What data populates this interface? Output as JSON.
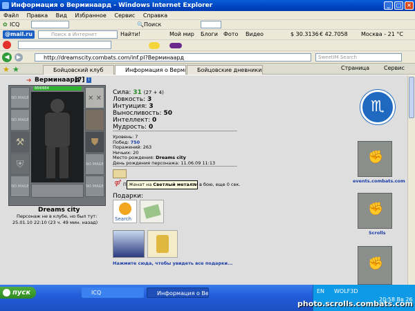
{
  "window": {
    "title": "Информация о Верминаард - Windows Internet Explorer"
  },
  "menu": [
    "Файл",
    "Правка",
    "Вид",
    "Избранное",
    "Сервис",
    "Справка"
  ],
  "toolbar1": {
    "icq": "ICQ",
    "search": "Поиск"
  },
  "toolbar2": {
    "brand": "@mail.ru",
    "search_placeholder": "Поиск в Интернет",
    "find": "Найти!",
    "my_world": "Мой мир",
    "blogs": "Блоги",
    "photo": "Фото",
    "video": "Видео",
    "usd": "$ 30.3136",
    "eur": "€ 42.7058",
    "weather": "Москва - 21 °C"
  },
  "address": {
    "url": "http://dreamscity.combats.com/inf.pl?Верминаард",
    "search_placeholder": "SweetIM Search"
  },
  "tabs": [
    "Бойцовский клуб",
    "Информация о Вермина...",
    "Бойцовские дневники - Све..."
  ],
  "tab_tools": {
    "page": "Страница",
    "service": "Сервис"
  },
  "character": {
    "name": "Верминаард",
    "level": "[7]",
    "hp": "664/664",
    "city": "Dreams city",
    "status_line": "Персонаж не в клубе, но был тут:",
    "last_seen": "25.01.10 22:10 (23 ч. 49 мин. назад)",
    "empty_slot": "NO IMAGE"
  },
  "stats": [
    {
      "label": "Сила:",
      "value": "31",
      "extra": "(27 + 4)"
    },
    {
      "label": "Ловкость:",
      "value": "3"
    },
    {
      "label": "Интуиция:",
      "value": "3"
    },
    {
      "label": "Выносливость:",
      "value": "50"
    },
    {
      "label": "Интеллект:",
      "value": "0"
    },
    {
      "label": "Мудрость:",
      "value": "0"
    }
  ],
  "details": {
    "level": "Уровень: 7",
    "wins_label": "Побед:",
    "wins": "750",
    "losses": "Поражений: 263",
    "draws": "Ничьих: 20",
    "birthplace_label": "Место рождения:",
    "birthplace": "Dreams city",
    "birthday": "День рождения персонажа: 11.06.09 11:13"
  },
  "married": {
    "tooltip_label": "Женат на",
    "tooltip_name": "Светлый металл",
    "line_prefix": "П",
    "line_rest": "ти в бою, еще 0 сек."
  },
  "gifts": {
    "label": "Подарки:",
    "gift1": "Search",
    "more": "Нажмите сюда, чтобы увидеть все подарки..."
  },
  "right_panel": {
    "events": "events.combats.com",
    "scrolls": "Scrolls"
  },
  "taskbar": {
    "start": "пуск",
    "tasks": [
      "ICQ",
      "Информация о Верм..."
    ],
    "lang": "EN",
    "user": "WOLF3D",
    "time": "20:58 Вв 26"
  },
  "watermark": "photo.scrolls.combats.com",
  "colors": {
    "hp": "#2fb02f",
    "titlebar": "#0a5fd8",
    "link": "#1a3ca8"
  }
}
